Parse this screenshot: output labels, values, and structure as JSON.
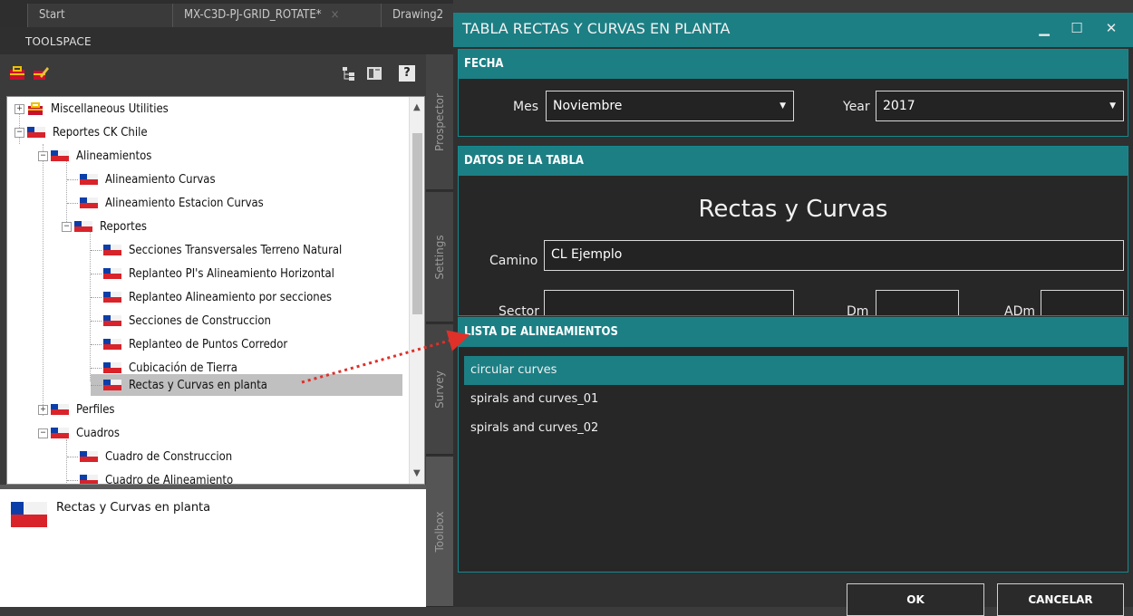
{
  "tabs": [
    {
      "label": "Start"
    },
    {
      "label": "MX-C3D-PJ-GRID_ROTATE*",
      "close": "×"
    },
    {
      "label": "Drawing2"
    }
  ],
  "toolspace": {
    "title": "TOOLSPACE",
    "help_glyph": "?"
  },
  "tree": [
    {
      "label": "Miscellaneous Utilities",
      "expander": "+"
    },
    {
      "label": "Reportes CK Chile",
      "expander": "−"
    },
    {
      "label": "Alineamientos",
      "expander": "−"
    },
    {
      "label": "Alineamiento Curvas"
    },
    {
      "label": "Alineamiento Estacion Curvas"
    },
    {
      "label": "Reportes",
      "expander": "−"
    },
    {
      "label": "Secciones Transversales Terreno Natural"
    },
    {
      "label": "Replanteo PI's Alineamiento Horizontal"
    },
    {
      "label": "Replanteo Alineamiento por secciones"
    },
    {
      "label": "Secciones de Construccion"
    },
    {
      "label": "Replanteo de Puntos Corredor"
    },
    {
      "label": "Cubicación de Tierra"
    },
    {
      "label": "Rectas y Curvas en planta"
    },
    {
      "label": "Perfiles",
      "expander": "+"
    },
    {
      "label": "Cuadros",
      "expander": "−"
    },
    {
      "label": "Cuadro de Construccion"
    },
    {
      "label": "Cuadro de Alineamiento"
    }
  ],
  "description": {
    "text": "Rectas y Curvas en planta"
  },
  "side_tabs": [
    "Prospector",
    "Settings",
    "Survey",
    "Toolbox"
  ],
  "dialog": {
    "title": "TABLA RECTAS Y CURVAS EN PLANTA",
    "window_buttons": {
      "minimize": "▁",
      "maximize": "☐",
      "close": "✕"
    },
    "fecha": {
      "header": "FECHA",
      "mes_label": "Mes",
      "mes_value": "Noviembre",
      "year_label": "Year",
      "year_value": "2017",
      "arrow": "▼"
    },
    "datos": {
      "header": "DATOS DE LA TABLA",
      "big_title": "Rectas y Curvas",
      "camino_label": "Camino",
      "camino_value": "CL Ejemplo",
      "sector_label": "Sector",
      "dm_label": "Dm",
      "adm_label": "ADm"
    },
    "lista": {
      "header": "LISTA DE ALINEAMIENTOS",
      "items": [
        "circular curves",
        "spirals and curves_01",
        "spirals and curves_02"
      ]
    },
    "buttons": {
      "ok": "OK",
      "cancel": "CANCELAR"
    }
  },
  "colors": {
    "accent": "#1c7f84",
    "annotation_arrow": "#e0302a"
  }
}
